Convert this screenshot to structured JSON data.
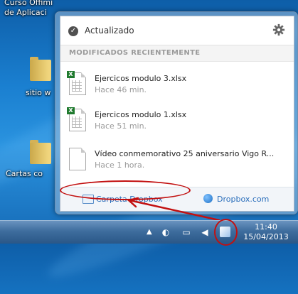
{
  "desktop": {
    "labels": {
      "top_line1": "Curso Offimi",
      "top_line2": "de Aplicaci",
      "sitio": "sitio w",
      "cartas": "Cartas co"
    }
  },
  "popup": {
    "status": "Actualizado",
    "section_title": "MODIFICADOS RECIENTEMENTE",
    "files": [
      {
        "name": "Ejercicos modulo 3.xlsx",
        "time": "Hace 46 min.",
        "type": "excel"
      },
      {
        "name": "Ejercicos modulo 1.xlsx",
        "time": "Hace 51 min.",
        "type": "excel"
      },
      {
        "name": "Vídeo conmemorativo 25 aniversario Vigo R...",
        "time": "Hace 1 hora.",
        "type": "document"
      }
    ],
    "footer": {
      "folder_link": "Carpeta Dropbox",
      "web_link": "Dropbox.com"
    }
  },
  "taskbar": {
    "time": "11:40",
    "date": "15/04/2013"
  },
  "colors": {
    "accent_red": "#c21010",
    "link_blue": "#2a6ebb"
  },
  "icons": [
    "check-icon",
    "gear-icon",
    "excel-file-icon",
    "document-file-icon",
    "folder-icon",
    "globe-icon",
    "dropbox-tray-icon"
  ]
}
